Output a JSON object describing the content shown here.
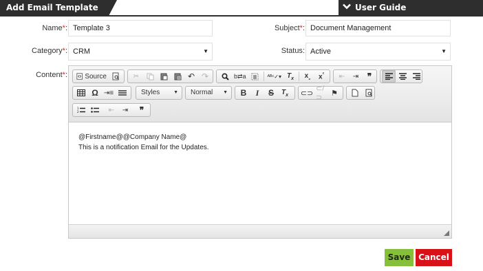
{
  "header": {
    "title": "Add Email Template",
    "user_guide": "User Guide"
  },
  "form": {
    "name": {
      "label": "Name",
      "required": "*",
      "colon": ":",
      "value": "Template 3"
    },
    "subject": {
      "label": "Subject",
      "required": "*",
      "colon": ":",
      "value": "Document Management"
    },
    "category": {
      "label": "Category",
      "required": "*",
      "colon": ":",
      "value": "CRM"
    },
    "status": {
      "label": "Status",
      "colon": ":",
      "value": "Active"
    },
    "content": {
      "label": "Content",
      "required": "*",
      "colon": ":"
    }
  },
  "editor": {
    "source_label": "Source",
    "styles_label": "Styles",
    "format_label": "Normal",
    "bold": "B",
    "italic": "I",
    "strike": "S",
    "omega": "Ω",
    "quote": "❞",
    "body_lines": [
      "@Firstname@@Company Name@",
      "This is a notification Email for the Updates."
    ]
  },
  "actions": {
    "save": "Save",
    "cancel": "Cancel"
  },
  "colors": {
    "header_bg": "#2e2e2e",
    "required": "#d9232d",
    "save_bg": "#86bf3a",
    "cancel_bg": "#d81018"
  }
}
